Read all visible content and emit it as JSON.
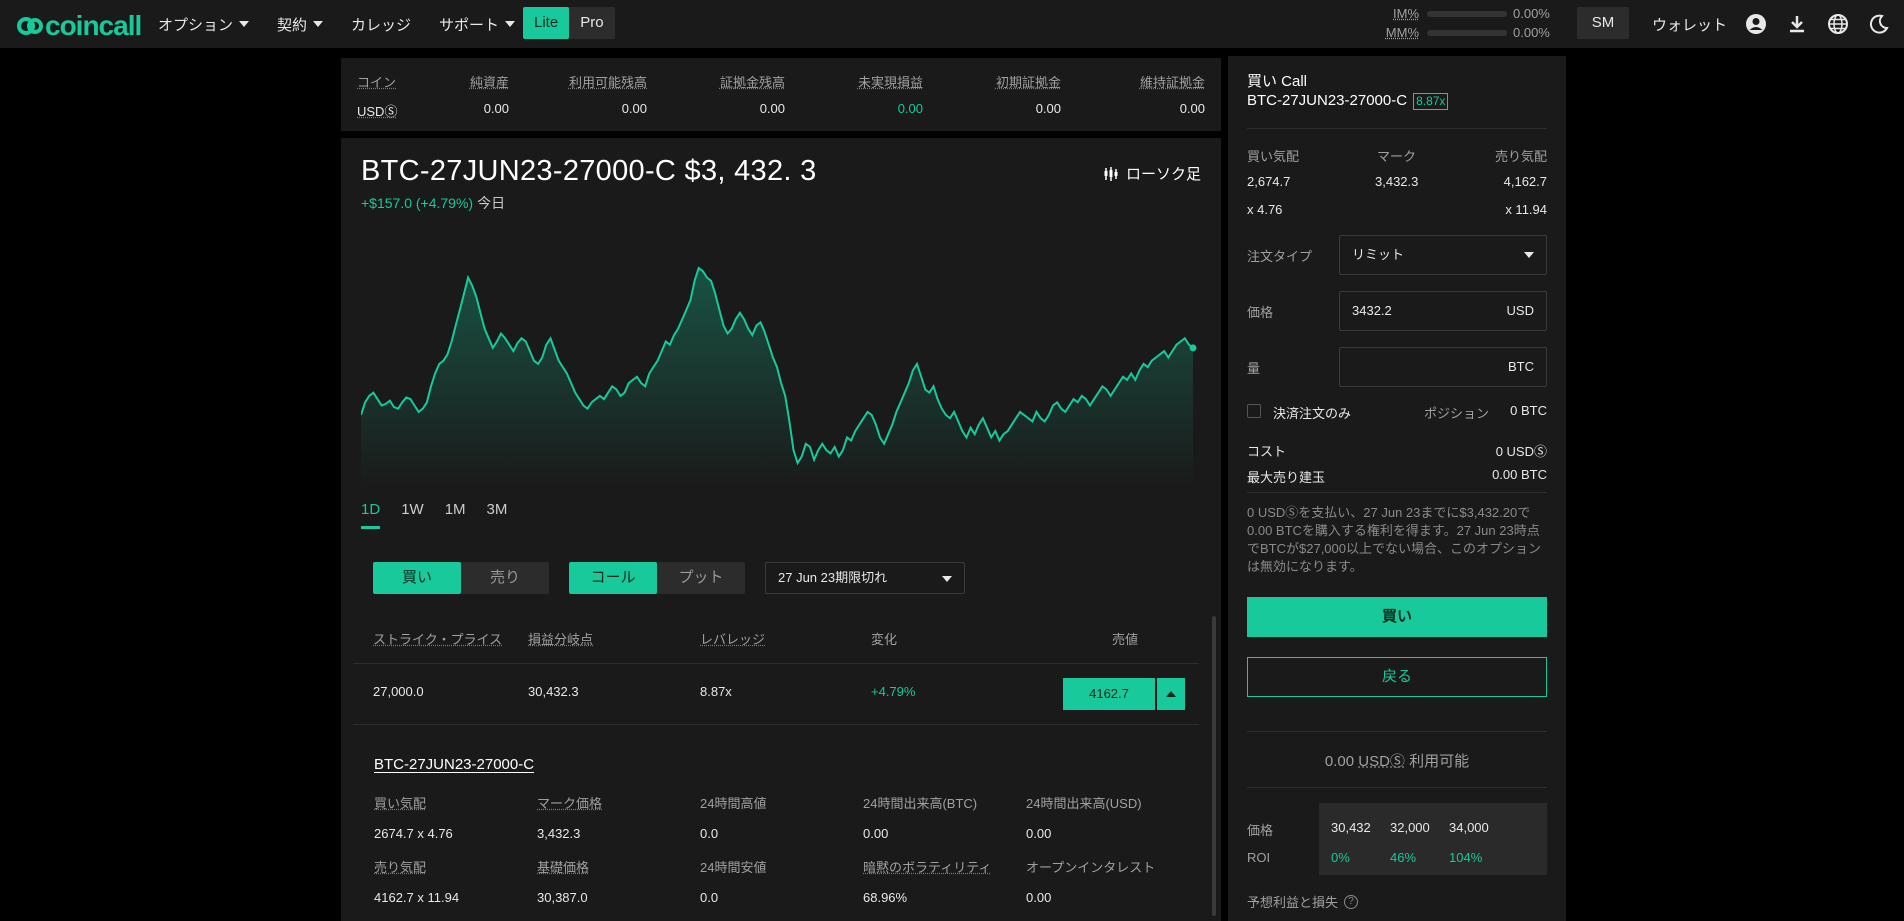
{
  "brand": {
    "logo_text": "coincall",
    "accent": "#17c99b"
  },
  "nav": {
    "options": "オプション",
    "contracts": "契約",
    "calendar": "カレッジ",
    "support": "サポート",
    "lite": "Lite",
    "pro": "Pro"
  },
  "header": {
    "im_label": "IM%",
    "im_value": "0.00%",
    "mm_label": "MM%",
    "mm_value": "0.00%",
    "sm": "SM",
    "wallet": "ウォレット",
    "icons": [
      "account-icon",
      "download-icon",
      "globe-icon",
      "moon-icon"
    ]
  },
  "balances": {
    "headers": [
      "コイン",
      "純資産",
      "利用可能残高",
      "証拠金残高",
      "未実現損益",
      "初期証拠金",
      "維持証拠金"
    ],
    "values": [
      "USDⓈ",
      "0.00",
      "0.00",
      "0.00",
      "0.00",
      "0.00",
      "0.00"
    ]
  },
  "asset": {
    "title": "BTC-27JUN23-27000-C $3, 432. 3",
    "change": "+$157.0 (+4.79%)",
    "period": "今日",
    "candle_label": "ローソク足"
  },
  "chart_data": {
    "type": "area",
    "period": "1D",
    "values": [
      64,
      72,
      76,
      78,
      74,
      70,
      71,
      73,
      69,
      68,
      72,
      75,
      74,
      70,
      66,
      68,
      72,
      82,
      90,
      96,
      98,
      102,
      110,
      120,
      130,
      140,
      150,
      145,
      138,
      128,
      118,
      112,
      106,
      110,
      115,
      112,
      108,
      104,
      109,
      112,
      110,
      104,
      98,
      96,
      100,
      108,
      112,
      105,
      98,
      94,
      90,
      84,
      78,
      74,
      70,
      68,
      72,
      74,
      76,
      74,
      78,
      82,
      80,
      76,
      78,
      84,
      86,
      88,
      84,
      82,
      90,
      94,
      98,
      104,
      110,
      108,
      114,
      118,
      124,
      130,
      136,
      148,
      156,
      154,
      150,
      148,
      140,
      130,
      120,
      115,
      118,
      124,
      128,
      124,
      118,
      114,
      120,
      122,
      116,
      108,
      100,
      94,
      84,
      76,
      60,
      42,
      34,
      38,
      46,
      44,
      36,
      42,
      46,
      42,
      40,
      44,
      38,
      42,
      50,
      48,
      54,
      58,
      62,
      66,
      64,
      58,
      50,
      46,
      52,
      58,
      66,
      72,
      78,
      84,
      92,
      96,
      88,
      80,
      78,
      82,
      74,
      68,
      64,
      62,
      66,
      60,
      54,
      50,
      56,
      52,
      58,
      62,
      56,
      50,
      54,
      48,
      52,
      54,
      58,
      62,
      66,
      64,
      62,
      60,
      66,
      62,
      60,
      64,
      70,
      72,
      68,
      66,
      70,
      74,
      72,
      76,
      74,
      70,
      74,
      78,
      82,
      80,
      76,
      80,
      84,
      88,
      86,
      90,
      86,
      92,
      96,
      94,
      98,
      100,
      102,
      104,
      100,
      104,
      108,
      110,
      112,
      108,
      106
    ],
    "timeframes": [
      "1D",
      "1W",
      "1M",
      "3M"
    ]
  },
  "trade": {
    "buy": "買い",
    "sell": "売り",
    "call": "コール",
    "put": "プット",
    "expiry": "27 Jun 23期限切れ"
  },
  "table": {
    "headers": [
      "ストライク・プライス",
      "損益分岐点",
      "レバレッジ",
      "変化",
      "売値"
    ],
    "row": {
      "strike": "27,000.0",
      "breakeven": "30,432.3",
      "leverage": "8.87x",
      "change": "+4.79%",
      "ask": "4162.7"
    }
  },
  "details": {
    "title": "BTC-27JUN23-27000-C",
    "row1": [
      {
        "label": "買い気配",
        "value": "2674.7 x 4.76"
      },
      {
        "label": "マーク価格",
        "value": "3,432.3"
      },
      {
        "label": "24時間高値",
        "value": "0.0"
      },
      {
        "label": "24時間出来高(BTC)",
        "value": "0.00"
      },
      {
        "label": "24時間出来高(USD)",
        "value": "0.00"
      }
    ],
    "row2": [
      {
        "label": "売り気配",
        "value": "4162.7 x 11.94"
      },
      {
        "label": "基礎価格",
        "value": "30,387.0"
      },
      {
        "label": "24時間安値",
        "value": "0.0"
      },
      {
        "label": "暗黙のボラティリティ",
        "value": "68.96%"
      },
      {
        "label": "オープンインタレスト",
        "value": "0.00"
      }
    ]
  },
  "order": {
    "title": "買い Call",
    "instrument": "BTC-27JUN23-27000-C",
    "leverage": "8.87x",
    "bid_label": "買い気配",
    "mark_label": "マーク",
    "ask_label": "売り気配",
    "bid": "2,674.7",
    "mark": "3,432.3",
    "ask": "4,162.7",
    "bid_size": "x 4.76",
    "ask_size": "x 11.94",
    "order_type_label": "注文タイプ",
    "order_type": "リミット",
    "price_label": "価格",
    "price": "3432.2",
    "price_unit": "USD",
    "qty_label": "量",
    "qty": "",
    "qty_unit": "BTC",
    "reduce_only": "決済注文のみ",
    "position_label": "ポジション",
    "position": "0 BTC",
    "cost_label": "コスト",
    "cost": "0 USDⓈ",
    "max_short_label": "最大売り建玉",
    "max_short": "0.00 BTC",
    "description": "0 USDⓈを支払い、27 Jun 23までに$3,432.20で0.00 BTCを購入する権利を得ます。27 Jun 23時点でBTCが$27,000以上でない場合、このオプションは無効になります。",
    "buy_button": "買い",
    "back_button": "戻る",
    "available_amount": "0.00",
    "available_unit": "USDⓈ",
    "available_suffix": "利用可能",
    "roi_price_label": "価格",
    "roi_label": "ROI",
    "roi_prices": [
      "30,432",
      "32,000",
      "34,000"
    ],
    "roi_values": [
      "0%",
      "46%",
      "104%"
    ],
    "pnl_label": "予想利益と損失"
  }
}
